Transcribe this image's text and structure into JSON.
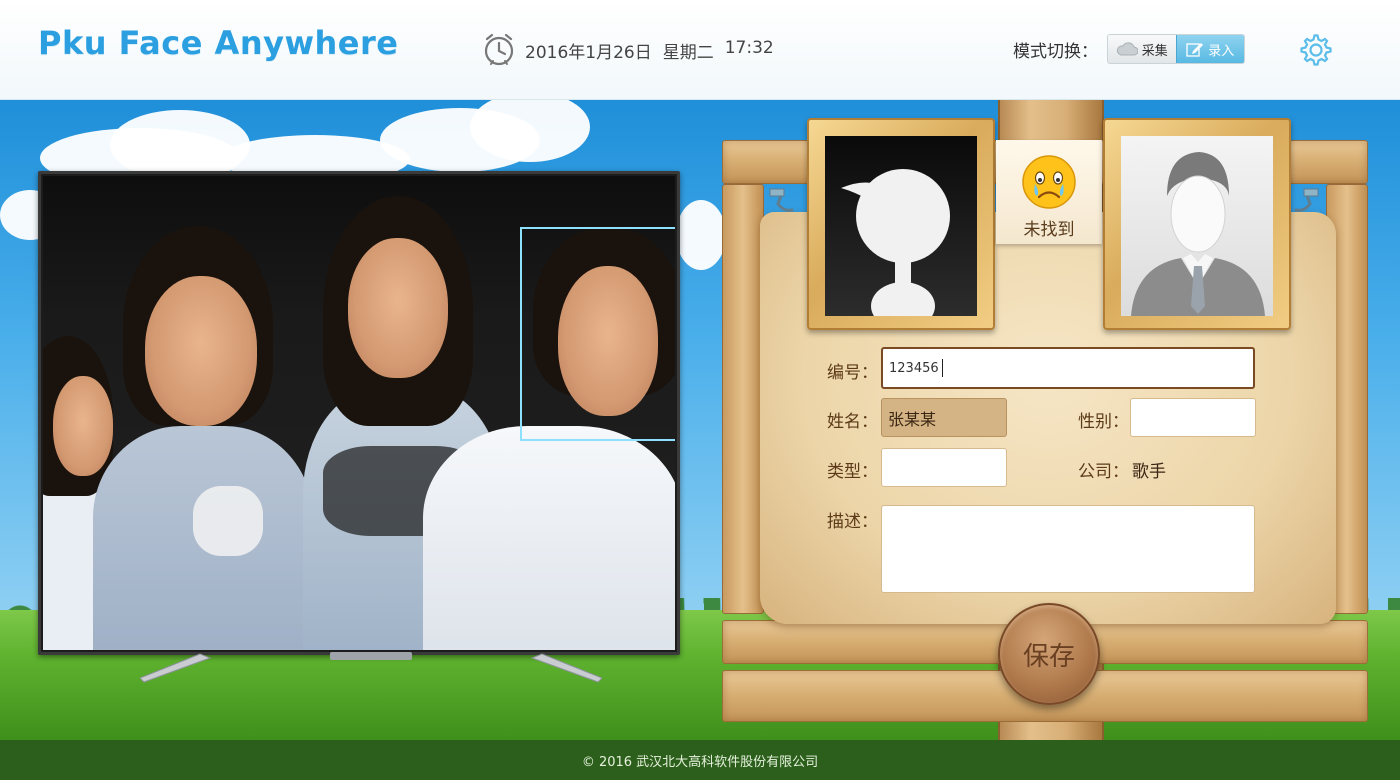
{
  "header": {
    "app_title": "Pku Face Anywhere",
    "date": "2016年1月26日",
    "weekday": "星期二",
    "time": "17:32",
    "mode_label": "模式切换：",
    "mode_options": {
      "collect": "采集",
      "entry": "录入"
    },
    "active_mode": "录入"
  },
  "match": {
    "not_found_text": "未找到"
  },
  "form": {
    "id_label": "编号：",
    "id_value": "123456",
    "name_label": "姓名：",
    "name_value": "张某某",
    "gender_label": "性别：",
    "gender_value": "",
    "type_label": "类型：",
    "type_value": "",
    "company_label": "公司：",
    "company_value": "歌手",
    "description_label": "描述：",
    "description_value": "",
    "save_label": "保存"
  },
  "footer": {
    "copyright": "© 2016 武汉北大高科软件股份有限公司"
  },
  "colors": {
    "brand_blue": "#2b9fe0",
    "face_box": "#8ee0ff",
    "toggle_active": "#58b9e3"
  },
  "icons": [
    "clock-icon",
    "gear-icon",
    "cloud-icon",
    "edit-icon",
    "crying-smiley-icon",
    "default-avatar-icon",
    "suit-silhouette-icon"
  ]
}
